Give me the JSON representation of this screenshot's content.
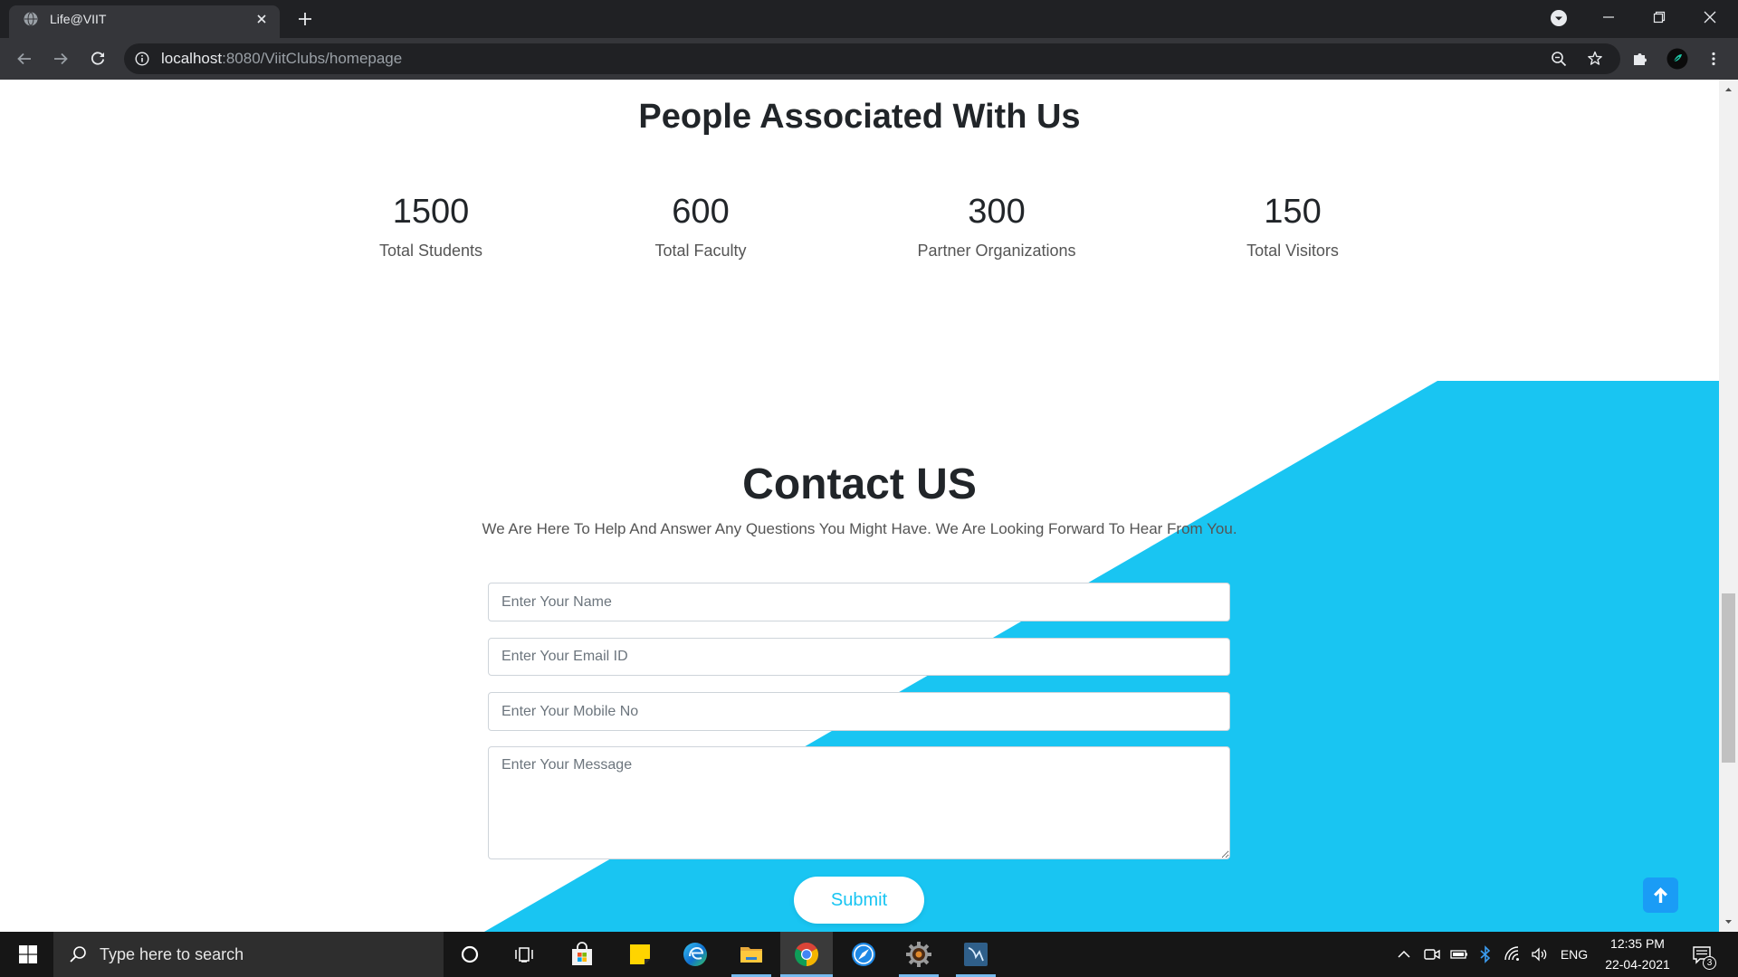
{
  "browser": {
    "tab": {
      "title": "Life@VIIT",
      "favicon": "globe-icon"
    },
    "address": {
      "host": "localhost",
      "path": ":8080/ViitClubs/homepage"
    }
  },
  "page": {
    "stats": {
      "title": "People Associated With Us",
      "items": [
        {
          "value": "1500",
          "label": "Total Students"
        },
        {
          "value": "600",
          "label": "Total Faculty"
        },
        {
          "value": "300",
          "label": "Partner Organizations"
        },
        {
          "value": "150",
          "label": "Total Visitors"
        }
      ]
    },
    "contact": {
      "title": "Contact US",
      "subtitle": "We Are Here To Help And Answer Any Questions You Might Have. We Are Looking Forward To Hear From You.",
      "name_placeholder": "Enter Your Name",
      "email_placeholder": "Enter Your Email ID",
      "mobile_placeholder": "Enter Your Mobile No",
      "message_placeholder": "Enter Your Message",
      "submit_label": "Submit"
    }
  },
  "colors": {
    "accent": "#19c5f2",
    "scroll_top_button": "#1a9cf6",
    "heading": "#212529"
  },
  "taskbar": {
    "search_placeholder": "Type here to search",
    "pinned_apps": [
      "store-icon",
      "sticky-notes-icon",
      "edge-icon",
      "file-explorer-icon",
      "chrome-icon",
      "compass-app-icon",
      "gear-app-icon",
      "workbench-app-icon"
    ],
    "tray": {
      "language": "ENG",
      "time": "12:35 PM",
      "date": "22-04-2021",
      "notification_count": "3"
    }
  }
}
